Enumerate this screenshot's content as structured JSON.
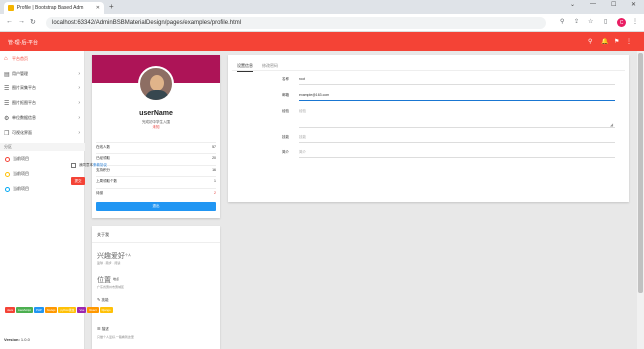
{
  "browser": {
    "tab_title": "Profile | Bootstrap Based Adm",
    "url": "localhost:63342/AdminBSBMaterialDesign/pages/examples/profile.html",
    "profile_initial": "C"
  },
  "appbar": {
    "brand": "管-理-后-平台"
  },
  "sidebar": {
    "items": [
      {
        "label": "平台首页",
        "active": true
      },
      {
        "label": "用户管理"
      },
      {
        "label": "图片采集平台"
      },
      {
        "label": "图片抠图平台"
      },
      {
        "label": "单位数据信息"
      },
      {
        "label": "可视化界面"
      }
    ],
    "section_label": "分区",
    "rings": [
      {
        "label": "当前项目",
        "color": "#f44336"
      },
      {
        "label": "当前项目",
        "color": "#ffc107"
      },
      {
        "label": "当前项目",
        "color": "#03a9f4"
      }
    ],
    "version_label": "Version:",
    "version": "1.0.0"
  },
  "profile": {
    "username": "userName",
    "tagline": "完成初中学生入围",
    "role": "未知",
    "stats": [
      {
        "label": "在线人数",
        "value": "57",
        "red": false
      },
      {
        "label": "已经领取",
        "value": "20",
        "red": false
      },
      {
        "label": "支持积分",
        "value": "16",
        "red": false
      },
      {
        "label": "上周领取个数",
        "value": "1",
        "red": false
      },
      {
        "label": "待缴",
        "value": "2",
        "red": true
      }
    ],
    "follow_button": "退出"
  },
  "about": {
    "title": "关于我",
    "interest": "兴趣爱好",
    "interest_sub": "个人",
    "interest_small": "篮球 · 跑步 · 阅读",
    "location": "位置",
    "location_sub": "地点",
    "location_small": "广东省惠州市惠城区",
    "skills_label": "技能",
    "skills": [
      {
        "name": "Java",
        "color": "#f44336"
      },
      {
        "name": "JavaScript",
        "color": "#4caf50"
      },
      {
        "name": "PHP",
        "color": "#2196f3"
      },
      {
        "name": "Nodejs",
        "color": "#ff9800"
      },
      {
        "name": "python爬虫",
        "color": "#ffc107"
      },
      {
        "name": "Vue",
        "color": "#9c27b0"
      },
      {
        "name": "React",
        "color": "#ff9800"
      },
      {
        "name": "Django",
        "color": "#ffc107"
      }
    ],
    "desc_label": "描述",
    "desc_small": "只做个人爱好,一路看到这里"
  },
  "settings": {
    "tabs": [
      "设置信息",
      "修改密码"
    ],
    "fields": [
      {
        "label": "名称",
        "value": "root",
        "placeholder": ""
      },
      {
        "label": "邮箱",
        "value": "example@163.com",
        "placeholder": ""
      },
      {
        "label": "经验",
        "value": "",
        "placeholder": "经验"
      },
      {
        "label": "技能",
        "value": "",
        "placeholder": "技能"
      },
      {
        "label": "简介",
        "value": "",
        "placeholder": "简介"
      }
    ],
    "agree_text": "我同意本",
    "agree_link": "条款协议",
    "submit": "提交"
  }
}
